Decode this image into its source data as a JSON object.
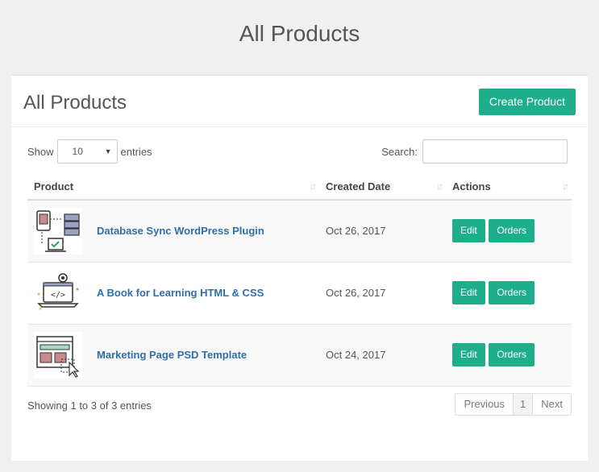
{
  "page_title": "All Products",
  "card": {
    "title": "All Products",
    "create_button": "Create Product"
  },
  "controls": {
    "show_label": "Show",
    "entries_value": "10",
    "entries_label": "entries",
    "search_label": "Search:",
    "search_value": ""
  },
  "table": {
    "headers": [
      "Product",
      "Created Date",
      "Actions"
    ],
    "rows": [
      {
        "name": "Database Sync WordPress Plugin",
        "date": "Oct 26, 2017",
        "icon": "database-sync-icon"
      },
      {
        "name": "A Book for Learning HTML & CSS",
        "date": "Oct 26, 2017",
        "icon": "code-laptop-icon"
      },
      {
        "name": "Marketing Page PSD Template",
        "date": "Oct 24, 2017",
        "icon": "web-template-icon"
      }
    ],
    "edit_label": "Edit",
    "orders_label": "Orders"
  },
  "footer": {
    "info": "Showing 1 to 3 of 3 entries",
    "previous": "Previous",
    "page": "1",
    "next": "Next"
  },
  "colors": {
    "accent": "#1fae8c",
    "link": "#2f6fa8"
  }
}
